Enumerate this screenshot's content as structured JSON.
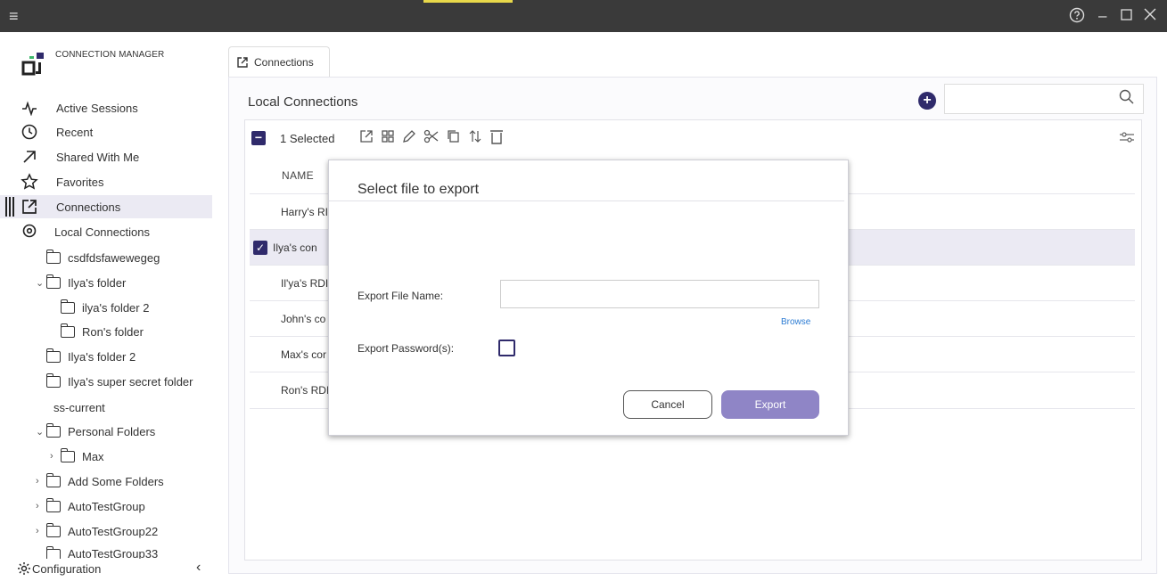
{
  "sidebar": {
    "logo_text": "CONNECTION MANAGER",
    "nav": [
      {
        "label": "Active Sessions",
        "icon": "activity-icon"
      },
      {
        "label": "Recent",
        "icon": "clock-icon"
      },
      {
        "label": "Shared With Me",
        "icon": "arrow-up-right-icon"
      },
      {
        "label": "Favorites",
        "icon": "star-icon"
      },
      {
        "label": "Connections",
        "icon": "external-link-icon"
      },
      {
        "label": "Local Connections",
        "icon": "location-pin-icon"
      }
    ],
    "tree": [
      {
        "label": "csdfdsfawewegeg"
      },
      {
        "label": "Ilya's folder"
      },
      {
        "label": "ilya's folder 2"
      },
      {
        "label": "Ron's folder"
      },
      {
        "label": "Ilya's folder 2"
      },
      {
        "label": "Ilya's super secret folder"
      },
      {
        "label": "ss-current"
      },
      {
        "label": "Personal Folders"
      },
      {
        "label": "Max"
      },
      {
        "label": "Add Some Folders"
      },
      {
        "label": "AutoTestGroup"
      },
      {
        "label": "AutoTestGroup22"
      },
      {
        "label": "AutoTestGroup33"
      }
    ],
    "configuration": "Configuration"
  },
  "tab": {
    "label": "Connections"
  },
  "main": {
    "title": "Local Connections",
    "selected_text": "1 Selected",
    "column_name": "NAME",
    "rows": [
      "Harry's RI",
      "Ilya's con",
      "Il'ya's RDI",
      "John's co",
      "Max's cor",
      "Ron's RDI"
    ]
  },
  "modal": {
    "title": "Select file to export",
    "file_label": "Export File Name:",
    "file_value": "",
    "browse": "Browse",
    "password_label": "Export Password(s):",
    "cancel": "Cancel",
    "export": "Export"
  },
  "colors": {
    "accent": "#2f2a6b",
    "export_button": "#8f85c6",
    "titlebar": "#3a3a3a"
  }
}
